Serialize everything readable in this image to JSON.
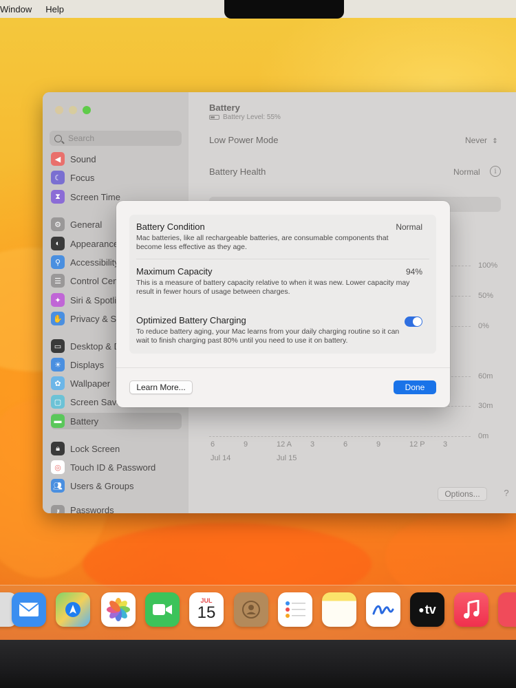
{
  "menubar": {
    "items": [
      "Window",
      "Help"
    ]
  },
  "sidebar": {
    "search_placeholder": "Search",
    "items": [
      {
        "label": "Sound",
        "icon": "speaker-icon",
        "color": "#e9706c"
      },
      {
        "label": "Focus",
        "icon": "moon-icon",
        "color": "#7a6fd1"
      },
      {
        "label": "Screen Time",
        "icon": "hourglass-icon",
        "color": "#8b6cd6"
      },
      {
        "label": "General",
        "icon": "gear-icon",
        "color": "#9a9898"
      },
      {
        "label": "Appearance",
        "icon": "appearance-icon",
        "color": "#3a3a3a"
      },
      {
        "label": "Accessibility",
        "icon": "accessibility-icon",
        "color": "#4a8fe0"
      },
      {
        "label": "Control Center",
        "icon": "control-center-icon",
        "color": "#9a9898"
      },
      {
        "label": "Siri & Spotlight",
        "icon": "siri-icon",
        "color": "#c066d6"
      },
      {
        "label": "Privacy & Security",
        "icon": "hand-icon",
        "color": "#4a8fe0"
      },
      {
        "label": "Desktop & Dock",
        "icon": "dock-icon",
        "color": "#3a3a3a"
      },
      {
        "label": "Displays",
        "icon": "sun-icon",
        "color": "#4a8fe0"
      },
      {
        "label": "Wallpaper",
        "icon": "flower-icon",
        "color": "#6cb6e8"
      },
      {
        "label": "Screen Saver",
        "icon": "screen-saver-icon",
        "color": "#6cc2d6"
      },
      {
        "label": "Battery",
        "icon": "battery-icon",
        "color": "#5ac75a"
      },
      {
        "label": "Lock Screen",
        "icon": "lock-icon",
        "color": "#3a3a3a"
      },
      {
        "label": "Touch ID & Password",
        "icon": "fingerprint-icon",
        "color": "#e9706c"
      },
      {
        "label": "Users & Groups",
        "icon": "users-icon",
        "color": "#4a8fe0"
      },
      {
        "label": "Passwords",
        "icon": "key-icon",
        "color": "#9a9898"
      }
    ]
  },
  "main": {
    "title": "Battery",
    "subtitle": "Battery Level: 55%",
    "low_power_label": "Low Power Mode",
    "low_power_value": "Never",
    "health_label": "Battery Health",
    "health_value": "Normal",
    "chart_right_labels": [
      "100%",
      "50%",
      "0%",
      "60m",
      "30m",
      "0m"
    ],
    "chart_x_ticks": [
      "6",
      "9",
      "12 A",
      "3",
      "6",
      "9",
      "12 P",
      "3"
    ],
    "chart_dates": [
      "Jul 14",
      "Jul 15"
    ],
    "options_label": "Options...",
    "help_label": "?"
  },
  "modal": {
    "condition_title": "Battery Condition",
    "condition_value": "Normal",
    "condition_desc": "Mac batteries, like all rechargeable batteries, are consumable components that become less effective as they age.",
    "capacity_title": "Maximum Capacity",
    "capacity_value": "94%",
    "capacity_desc": "This is a measure of battery capacity relative to when it was new. Lower capacity may result in fewer hours of usage between charges.",
    "optimized_title": "Optimized Battery Charging",
    "optimized_on": true,
    "optimized_desc": "To reduce battery aging, your Mac learns from your daily charging routine so it can wait to finish charging past 80% until you need to use it on battery.",
    "learn_more_label": "Learn More...",
    "done_label": "Done"
  },
  "dock": {
    "calendar_month": "JUL",
    "calendar_day": "15",
    "tv_label": "tv",
    "apps": [
      {
        "name": "mail-app-icon",
        "color": "#3a8ef0"
      },
      {
        "name": "maps-app-icon",
        "color": "#55b85e"
      },
      {
        "name": "photos-app-icon",
        "color": "#ffffff"
      },
      {
        "name": "facetime-app-icon",
        "color": "#3cc35a"
      },
      {
        "name": "calendar-app-icon",
        "color": "#ffffff"
      },
      {
        "name": "contacts-app-icon",
        "color": "#b38a5b"
      },
      {
        "name": "reminders-app-icon",
        "color": "#ffffff"
      },
      {
        "name": "notes-app-icon",
        "color": "#fbe36a"
      },
      {
        "name": "freeform-app-icon",
        "color": "#ffffff"
      },
      {
        "name": "tv-app-icon",
        "color": "#111111"
      },
      {
        "name": "music-app-icon",
        "color": "#f2425a"
      },
      {
        "name": "news-app-icon",
        "color": "#f04b5a"
      }
    ]
  }
}
